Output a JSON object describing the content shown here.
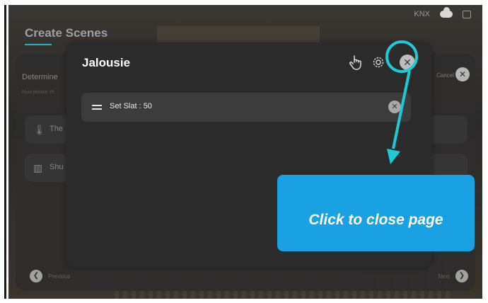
{
  "status_bar": {
    "protocol": "KNX",
    "icons": [
      "cloud-icon",
      "display-icon"
    ]
  },
  "background": {
    "page_title": "Create Scenes",
    "determine_label": "Determine",
    "instruction": "Now please ch",
    "rows": [
      {
        "icon": "thermometer-icon",
        "label": "The"
      },
      {
        "icon": "shutter-icon",
        "label": "Shu"
      }
    ],
    "cancel_label": "Cancel",
    "previous_label": "Previous",
    "next_label": "Next"
  },
  "modal": {
    "title": "Jalousie",
    "slat_item": "Set Slat : 50"
  },
  "annotation": {
    "callout_text": "Click to close page",
    "accent": "#1ecad6",
    "callout_color": "#1aa1e4"
  }
}
